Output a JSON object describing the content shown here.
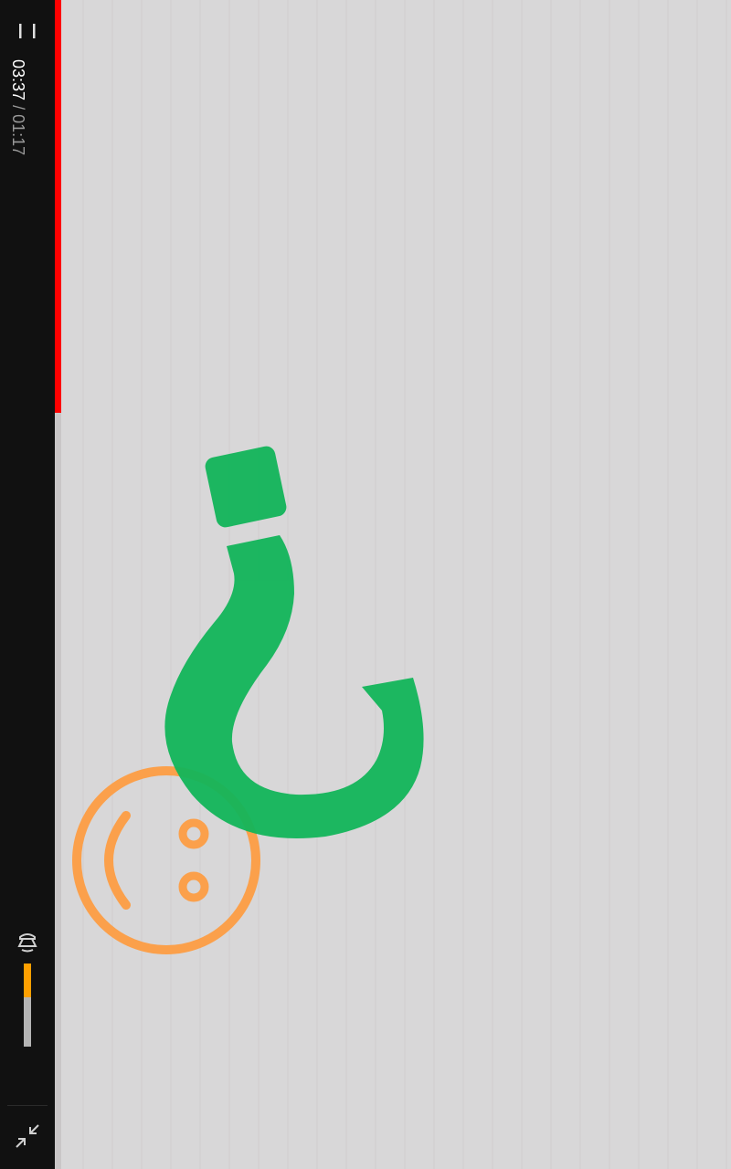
{
  "player": {
    "time": {
      "current": "03:37",
      "separator": "/",
      "duration": "01:17"
    },
    "progress": {
      "fraction": 0.353,
      "color": "#ff0000",
      "track_color": "#c9c6c7"
    },
    "volume": {
      "fraction": 0.41,
      "color": "#ffa000",
      "track_color": "#b5b5b5"
    },
    "controls": {
      "menu_icon": "menu-icon",
      "volume_icon": "volume-icon",
      "exit_fullscreen_icon": "exit-fullscreen-icon"
    }
  },
  "video": {
    "background": "#d8d7d8",
    "question_mark_color": "#12b55a",
    "smiley_color": "#ff9a3c"
  }
}
